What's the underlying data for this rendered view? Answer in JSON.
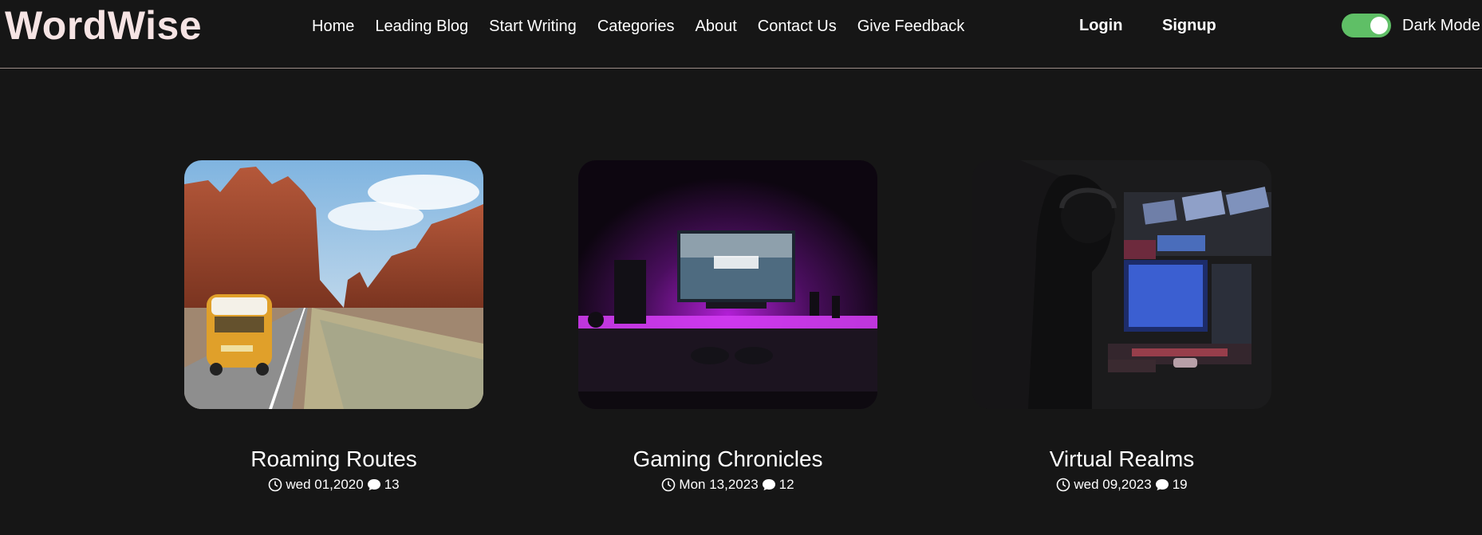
{
  "logo": "WordWise",
  "nav": {
    "links": [
      "Home",
      "Leading Blog",
      "Start Writing",
      "Categories",
      "About",
      "Contact Us",
      "Give Feedback"
    ]
  },
  "auth": {
    "login": "Login",
    "signup": "Signup"
  },
  "theme_toggle": {
    "label": "Dark Mode",
    "on": true,
    "color": "#5fbf66"
  },
  "cards": [
    {
      "title": "Roaming Routes",
      "date": "wed 01,2020",
      "comments": "13",
      "image": "road-trip-van-image"
    },
    {
      "title": "Gaming Chronicles",
      "date": "Mon 13,2023",
      "comments": "12",
      "image": "gaming-setup-image"
    },
    {
      "title": "Virtual Realms",
      "date": "wed 09,2023",
      "comments": "19",
      "image": "esports-gamer-image"
    }
  ],
  "colors": {
    "background": "#161616",
    "logo": "#f6e4e4",
    "divider": "#9a8c86"
  }
}
